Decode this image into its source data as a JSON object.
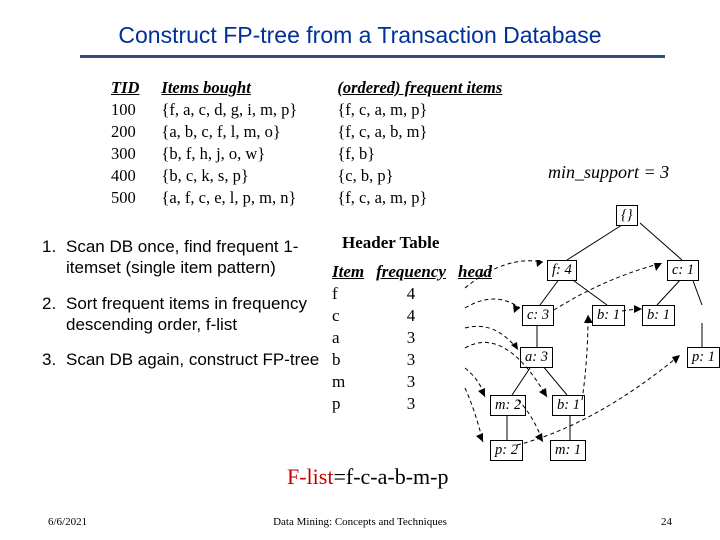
{
  "title": "Construct FP-tree from a Transaction Database",
  "table": {
    "h1": "TID",
    "h2": "Items bought",
    "h3": "(ordered) frequent items",
    "rows": [
      {
        "tid": "100",
        "items": "{f, a, c, d, g, i, m, p}",
        "freq": "{f, c, a, m, p}"
      },
      {
        "tid": "200",
        "items": "{a, b, c, f, l, m, o}",
        "freq": "{f, c, a, b, m}"
      },
      {
        "tid": "300",
        "items": "{b, f, h, j, o, w}",
        "freq": "{f, b}"
      },
      {
        "tid": "400",
        "items": "{b, c, k, s, p}",
        "freq": "{c, b, p}"
      },
      {
        "tid": "500",
        "items": "{a, f, c, e, l, p, m, n}",
        "freq": "{f, c, a, m, p}"
      }
    ]
  },
  "min_support": "min_support = 3",
  "steps": [
    "Scan DB once, find frequent 1-itemset (single item pattern)",
    "Sort frequent items in frequency descending order, f-list",
    "Scan DB again, construct FP-tree"
  ],
  "header_table": {
    "title": "Header Table",
    "h1": "Item",
    "h2": "frequency",
    "h3": "head",
    "rows": [
      {
        "item": "f",
        "freq": "4"
      },
      {
        "item": "c",
        "freq": "4"
      },
      {
        "item": "a",
        "freq": "3"
      },
      {
        "item": "b",
        "freq": "3"
      },
      {
        "item": "m",
        "freq": "3"
      },
      {
        "item": "p",
        "freq": "3"
      }
    ]
  },
  "flist": {
    "label": "F-list",
    "eq": "=f-c-a-b-m-p"
  },
  "tree": {
    "root": "{}",
    "nodes": {
      "f4": "f: 4",
      "c1": "c: 1",
      "c3": "c: 3",
      "b1a": "b: 1",
      "b1b": "b: 1",
      "a3": "a: 3",
      "p1": "p: 1",
      "m2": "m: 2",
      "b1c": "b: 1",
      "p2": "p: 2",
      "m1": "m: 1"
    }
  },
  "footer": {
    "date": "6/6/2021",
    "center": "Data Mining: Concepts and Techniques",
    "page": "24"
  }
}
